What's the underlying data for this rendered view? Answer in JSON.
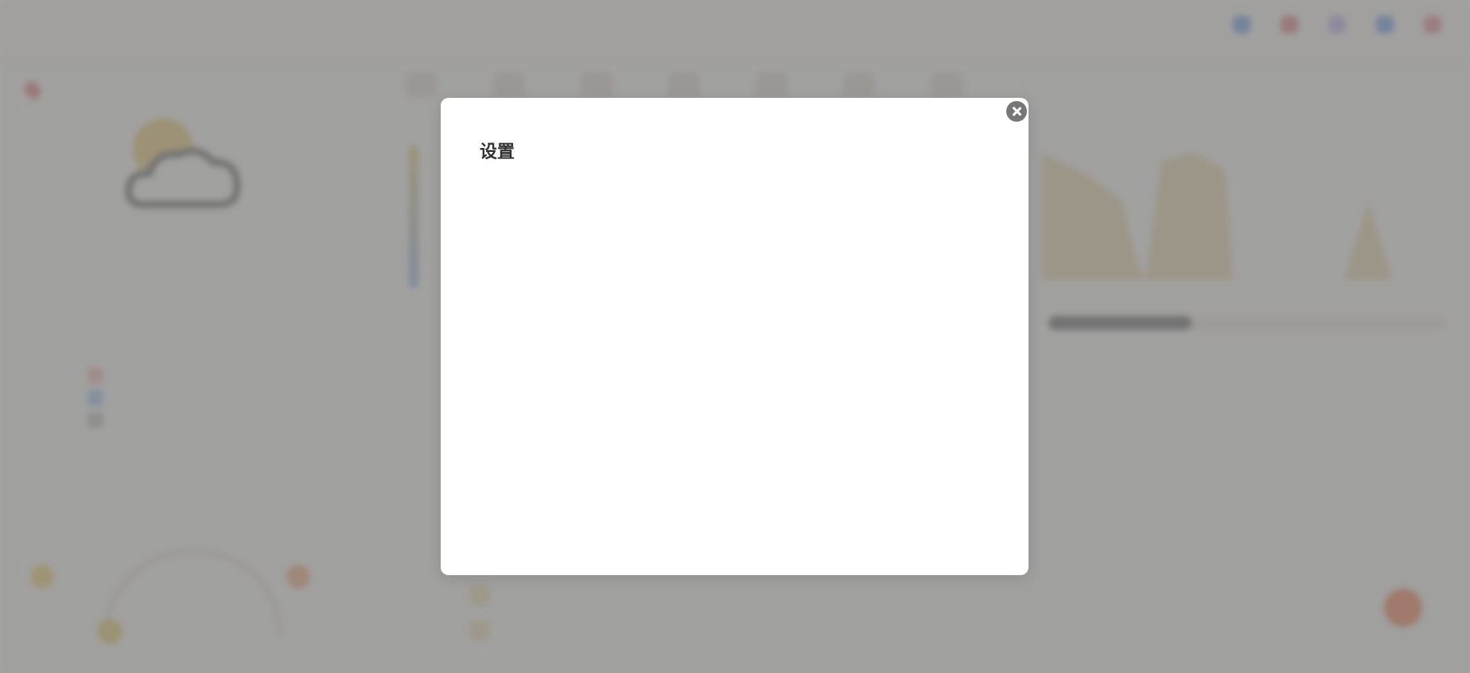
{
  "app": {
    "title": "",
    "top_nav": [
      {
        "label": "",
        "icon": "refresh-icon",
        "color": "#5b8fe0"
      },
      {
        "label": "",
        "icon": "location-icon",
        "color": "#e06b6b"
      },
      {
        "label": "",
        "icon": "theme-icon",
        "color": "#b9a7e6"
      },
      {
        "label": "",
        "icon": "language-icon",
        "color": "#5b8fe0"
      },
      {
        "label": "",
        "icon": "settings-icon",
        "color": "#e77b7b"
      }
    ]
  },
  "modal": {
    "title": "设置",
    "close_icon": "close-icon"
  },
  "colors": {
    "overlay": "#808080",
    "modal_bg": "#ffffff",
    "close_button": "#777777",
    "accent": "#f26b3a"
  }
}
